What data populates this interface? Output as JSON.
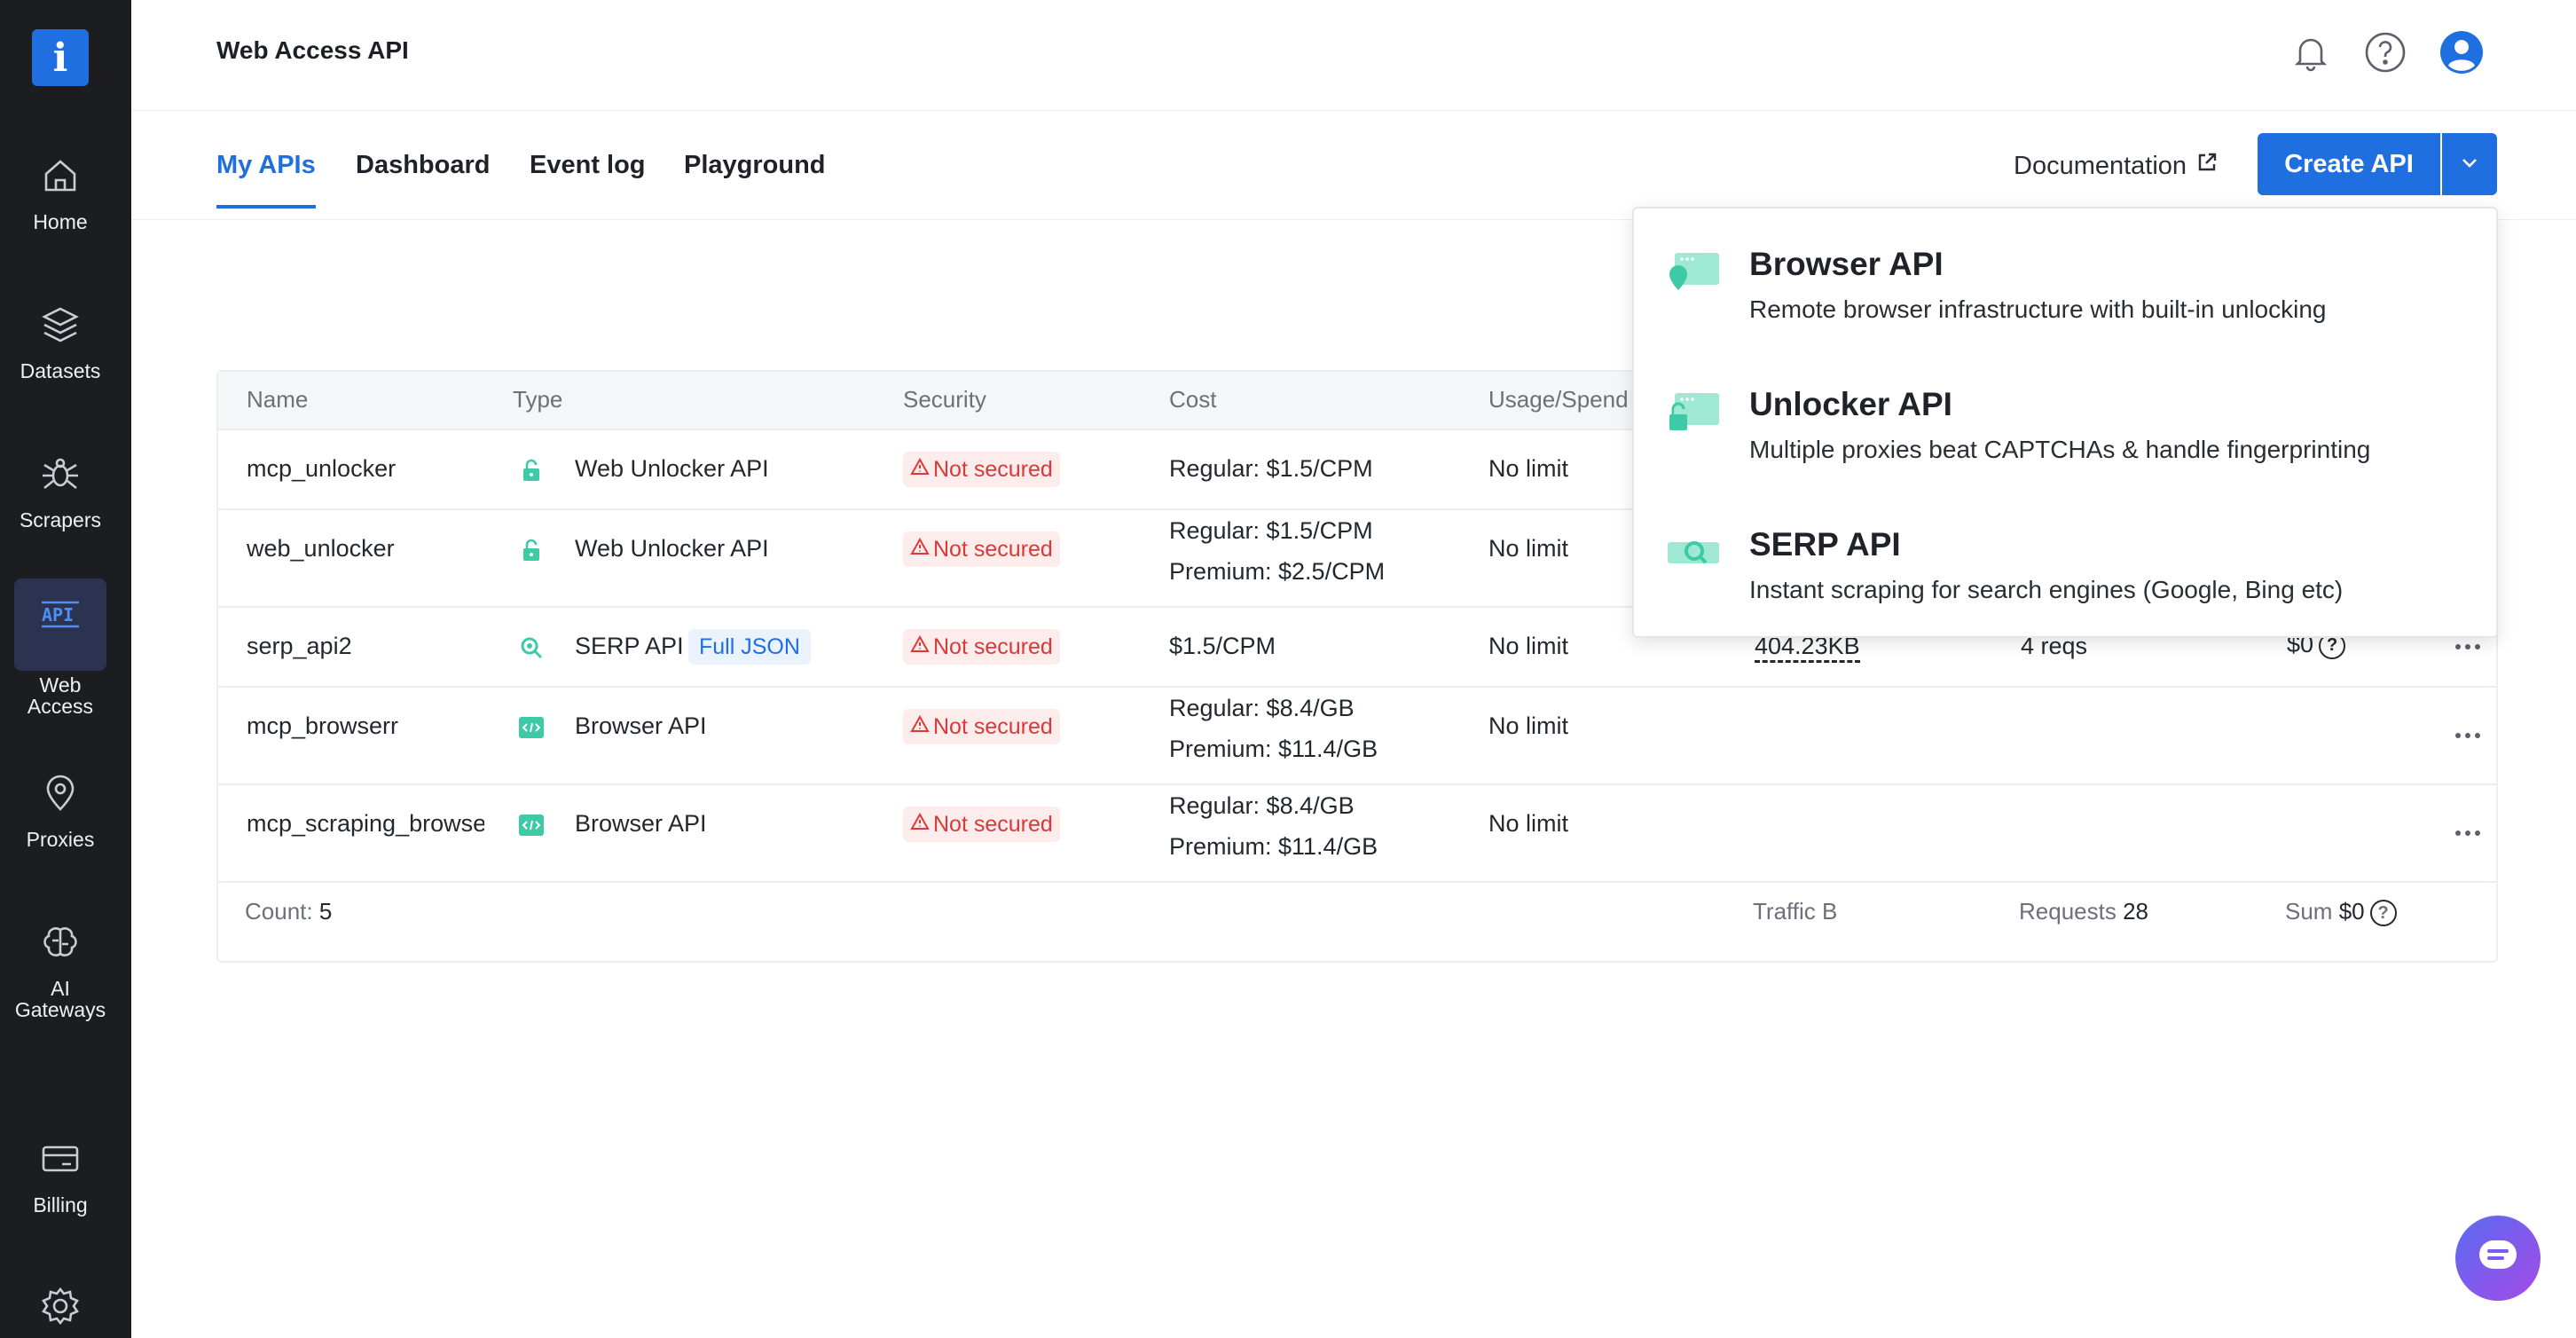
{
  "app": {
    "title": "Web Access API"
  },
  "colors": {
    "accent": "#1f6fe0",
    "sidebar": "#1c1d21",
    "danger": "#d83a3a",
    "teal": "#3ec9a7"
  },
  "sidebar": {
    "logo": "i",
    "items": [
      {
        "label": "Home",
        "icon": "home-icon"
      },
      {
        "label": "Datasets",
        "icon": "cube-stack-icon"
      },
      {
        "label": "Scrapers",
        "icon": "spider-icon"
      },
      {
        "label": "Web Access",
        "icon": "api-icon",
        "active": true
      },
      {
        "label": "Proxies",
        "icon": "location-pin-icon"
      },
      {
        "label": "AI Gateways",
        "icon": "brain-icon"
      },
      {
        "label": "Billing",
        "icon": "credit-card-icon"
      },
      {
        "label": "",
        "icon": "gear-icon"
      }
    ]
  },
  "header": {
    "icons": [
      "bell-icon",
      "help-icon",
      "user-avatar-icon"
    ]
  },
  "tabs": [
    {
      "label": "My APIs",
      "active": true
    },
    {
      "label": "Dashboard"
    },
    {
      "label": "Event log"
    },
    {
      "label": "Playground"
    }
  ],
  "actions": {
    "documentation": "Documentation",
    "create_api": "Create API"
  },
  "table": {
    "columns": [
      "Name",
      "Type",
      "Security",
      "Cost",
      "Usage/Spend"
    ],
    "rows": [
      {
        "name": "mcp_unlocker",
        "type": "Web Unlocker API",
        "type_icon": "unlock-icon",
        "security": "Not secured",
        "cost": [
          "Regular: $1.5/CPM"
        ],
        "usage": "No limit"
      },
      {
        "name": "web_unlocker",
        "type": "Web Unlocker API",
        "type_icon": "unlock-icon",
        "security": "Not secured",
        "cost": [
          "Regular: $1.5/CPM",
          "Premium: $2.5/CPM"
        ],
        "usage": "No limit"
      },
      {
        "name": "serp_api2",
        "type": "SERP API",
        "type_icon": "search-icon",
        "tag": "Full JSON",
        "security": "Not secured",
        "cost": [
          "$1.5/CPM"
        ],
        "usage": "No limit",
        "traffic": "404.23KB",
        "requests": "4 reqs",
        "sum": "$0"
      },
      {
        "name": "mcp_browserr",
        "type": "Browser API",
        "type_icon": "code-icon",
        "security": "Not secured",
        "cost": [
          "Regular: $8.4/GB",
          "Premium: $11.4/GB"
        ],
        "usage": "No limit"
      },
      {
        "name": "mcp_scraping_browse",
        "type": "Browser API",
        "type_icon": "code-icon",
        "security": "Not secured",
        "cost": [
          "Regular: $8.4/GB",
          "Premium: $11.4/GB"
        ],
        "usage": "No limit"
      }
    ],
    "footer": {
      "count_label": "Count:",
      "count": "5",
      "traffic_label": "Traffic",
      "traffic": "B",
      "requests_label": "Requests",
      "requests": "28",
      "sum_label": "Sum",
      "sum": "$0"
    }
  },
  "dropdown": {
    "items": [
      {
        "title": "Browser API",
        "desc": "Remote browser infrastructure with built-in unlocking",
        "icon": "browser-api-icon"
      },
      {
        "title": "Unlocker API",
        "desc": "Multiple proxies beat CAPTCHAs & handle fingerprinting",
        "icon": "unlocker-api-icon"
      },
      {
        "title": "SERP API",
        "desc": "Instant scraping for search engines (Google, Bing etc)",
        "icon": "serp-api-icon"
      }
    ]
  }
}
